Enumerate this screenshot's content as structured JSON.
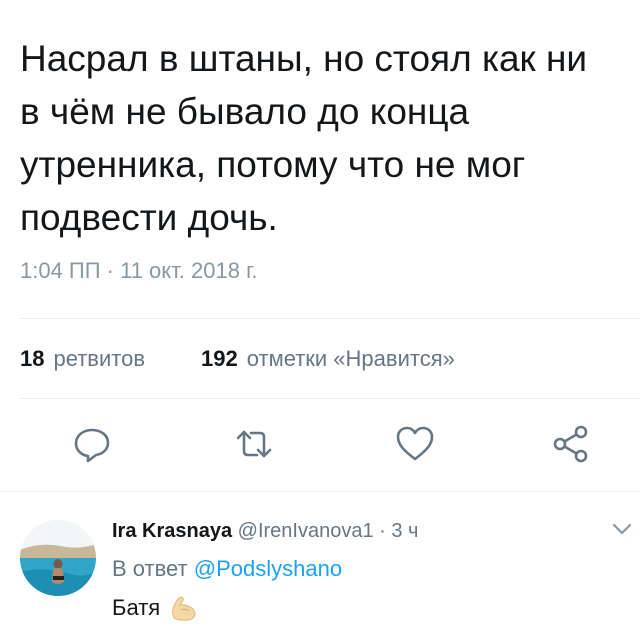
{
  "tweet": {
    "text": "Насрал в штаны, но стоял как ни\nв чём не бывало до конца\nутренника, потому что не мог\nподвести дочь.",
    "timestamp": "1:04 ПП · 11 окт. 2018 г."
  },
  "stats": {
    "retweets_count": "18",
    "retweets_label": "ретвитов",
    "likes_count": "192",
    "likes_label": "отметки «Нравится»"
  },
  "actions": [
    "reply-icon",
    "retweet-icon",
    "like-icon",
    "share-icon"
  ],
  "reply": {
    "display_name": "Ira Krasnaya",
    "handle": "@IrenIvanova1",
    "separator": "·",
    "time": "3 ч",
    "reply_prefix": "В ответ",
    "reply_mention": "@Podslyshano",
    "text": "Батя",
    "emoji": "flexed-biceps-icon"
  },
  "colors": {
    "accent": "#1da1f2",
    "secondary_text": "#657786",
    "icon_gray": "#657786"
  }
}
